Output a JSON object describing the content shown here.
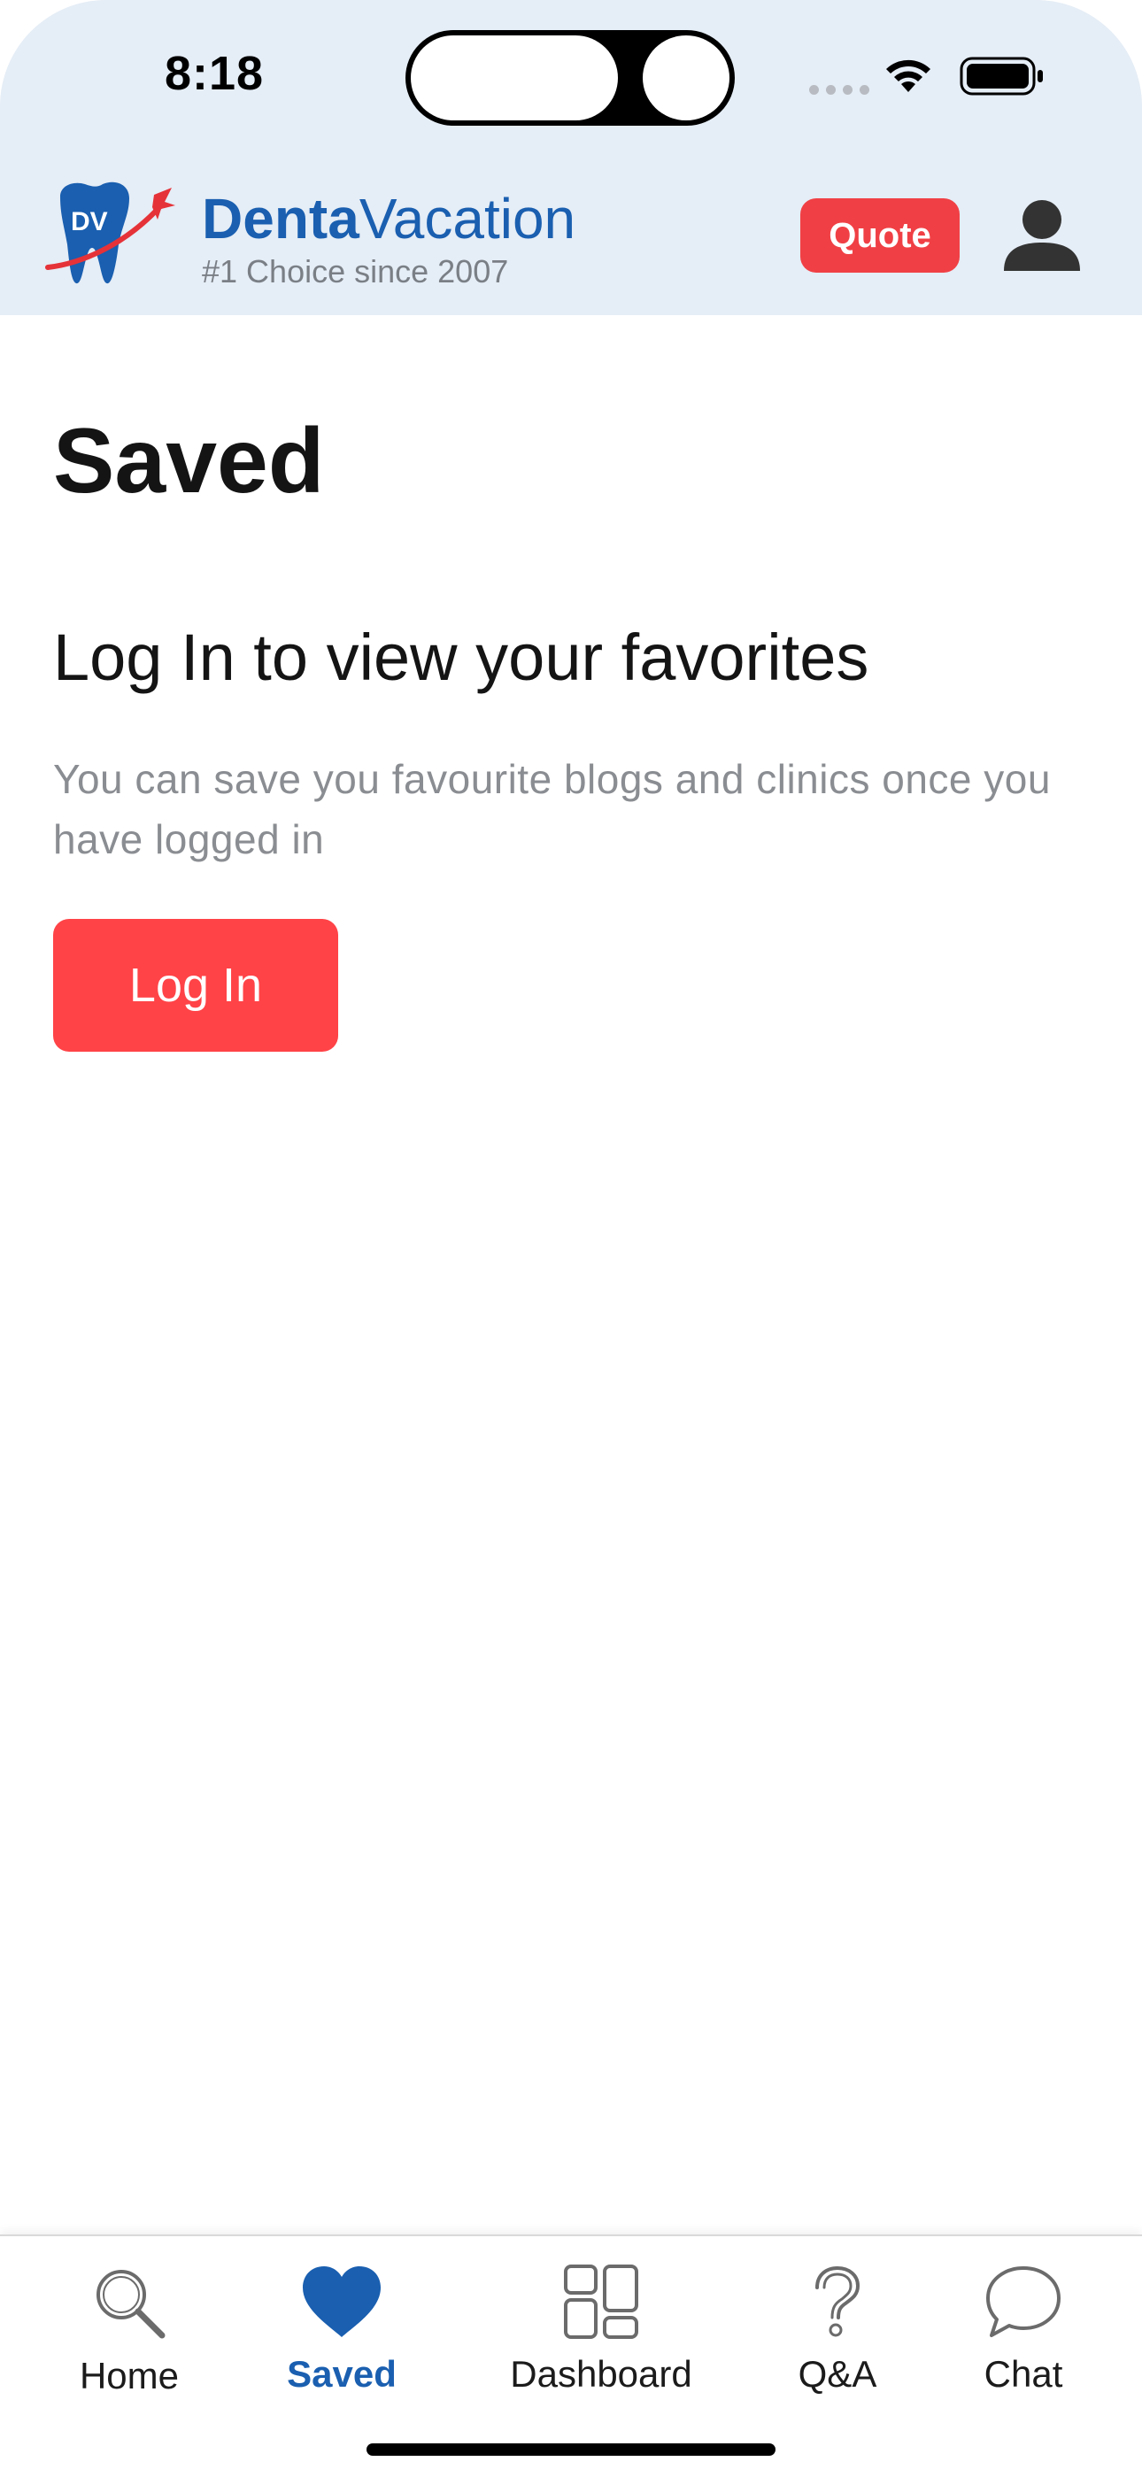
{
  "status_bar": {
    "time": "8:18"
  },
  "header": {
    "logo_text": "DV",
    "brand_part1": "Denta",
    "brand_part2": "Vacation",
    "tagline": "#1 Choice since 2007",
    "quote_label": "Quote"
  },
  "main": {
    "title": "Saved",
    "heading": "Log In to view your favorites",
    "description": "You can save you favourite blogs and clinics once you have logged in",
    "login_label": "Log In"
  },
  "tabbar": {
    "active": "Saved",
    "items": [
      {
        "label": "Home",
        "icon": "search-icon"
      },
      {
        "label": "Saved",
        "icon": "heart-icon"
      },
      {
        "label": "Dashboard",
        "icon": "dashboard-icon"
      },
      {
        "label": "Q&A",
        "icon": "question-icon"
      },
      {
        "label": "Chat",
        "icon": "chat-bubble-icon"
      }
    ]
  },
  "colors": {
    "brand_blue": "#1a5fb0",
    "accent_red": "#ff4347",
    "header_bg": "#e5edf6"
  }
}
